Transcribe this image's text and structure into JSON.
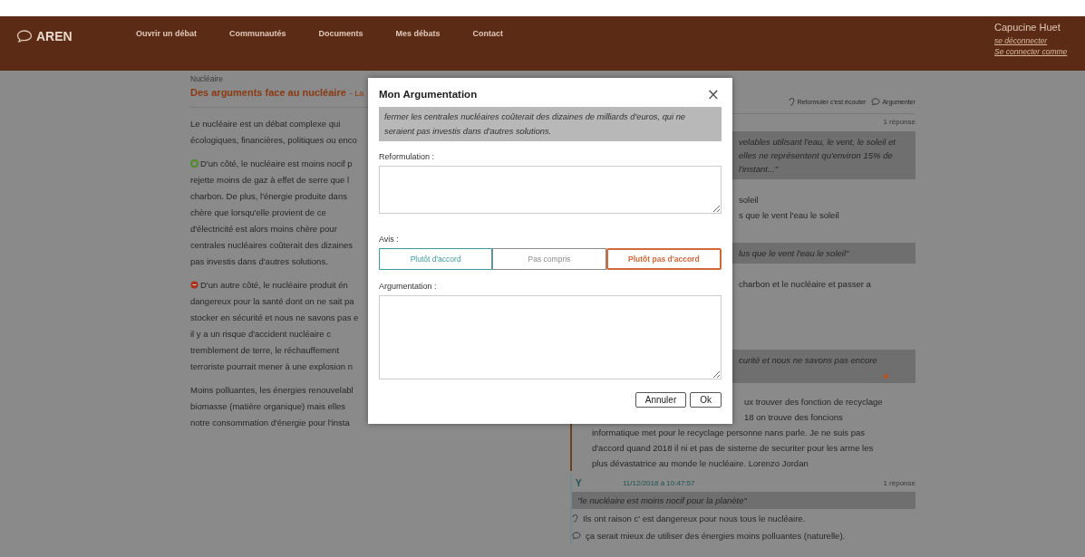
{
  "header": {
    "logo": "AREN",
    "nav": [
      {
        "label": "Ouvrir un débat"
      },
      {
        "label": "Communautés"
      },
      {
        "label": "Documents"
      },
      {
        "label": "Mes débats"
      },
      {
        "label": "Contact"
      }
    ],
    "user": {
      "name": "Capucine Huet",
      "links": [
        "se déconnecter",
        "Se connecter comme"
      ]
    }
  },
  "article": {
    "category": "Nucléaire",
    "title": "Des arguments face au nucléaire",
    "title_suffix": "- La",
    "paragraphs": [
      {
        "kind": "plain",
        "lines": [
          "Le nucléaire est un débat complexe qui",
          "écologiques, financières, politiques ou enco"
        ]
      },
      {
        "kind": "for",
        "lines": [
          "D'un côté, le nucléaire est moins nocif p",
          "rejette moins de gaz à effet de serre que l",
          "charbon. De plus, l'énergie produite dans",
          "chère que lorsqu'elle provient de ce",
          "d'électricité est alors moins chère pour",
          "centrales nucléaires coûterait des dizaines",
          "pas investis dans d'autres solutions."
        ]
      },
      {
        "kind": "against",
        "lines": [
          "D'un autre côté, le nucléaire produit én",
          "dangereux pour la santé dont on ne sait pa",
          "stocker en sécurité et nous ne savons pas e",
          "il y a un risque d'accident nucléaire c",
          "tremblement de terre, le réchauffement",
          "terroriste pourrait mener à une explosion n"
        ]
      },
      {
        "kind": "plain",
        "lines": [
          "Moins polluantes, les énergies renouvelabl",
          "biomasse (matière organique) mais elles",
          "notre consommation d'énergie pour l'insta"
        ]
      }
    ]
  },
  "discussion": {
    "actions": [
      {
        "kind": "reformulate",
        "label": "Reformuler c'est écouter"
      },
      {
        "kind": "argue",
        "label": "Argumenter"
      }
    ],
    "blocks": [
      {
        "kind": "count",
        "text": "1 réponse"
      },
      {
        "kind": "quote",
        "lines": [
          "velables utilisant l'eau, le vent, le soleil et",
          "elles ne représentent qu'environ 15% de",
          "l'instant...\""
        ]
      },
      {
        "kind": "text",
        "lines": [
          "soleil",
          "s que le vent l'eau le soleil"
        ]
      },
      {
        "kind": "quote",
        "lines": [
          "lus que le vent l'eau le soleil\""
        ]
      },
      {
        "kind": "text",
        "lines": [
          "charbon et le nucléaire et passer a"
        ]
      },
      {
        "kind": "quote",
        "lines": [
          "curité et nous ne savons pas encore"
        ]
      },
      {
        "kind": "reply",
        "lines": [
          {
            "kind": "partial",
            "text": "ux trouver des fonction de recyclage"
          },
          {
            "kind": "partial",
            "text": "18 on trouve des foncions"
          },
          {
            "kind": "full",
            "text": "informatique met pour le recyclage personne nans parle. Je ne suis pas"
          },
          {
            "kind": "full",
            "text": "d'accord quand 2018 il ni et pas de sisteme de securiter pour les arme les"
          },
          {
            "kind": "full",
            "text": "plus dévastatrice au monde le nucléaire. Lorenzo Jordan"
          }
        ]
      },
      {
        "kind": "comment",
        "author": "Y",
        "date": "11/12/2018 à 10:47:57",
        "count": "1 réponse",
        "quote": "\"le nucléaire est moins nocif pour la planète\"",
        "replies": [
          {
            "kind": "reformulation",
            "text": "Ils ont raison c' est dangereux pour nous tous le nucléaire."
          },
          {
            "kind": "argument",
            "text": "ça serait mieux de utiliser des énergies moins polluantes (naturelle)."
          }
        ]
      }
    ]
  },
  "modal": {
    "title": "Mon Argumentation",
    "close": "×",
    "quote": "fermer les centrales nucléaires coûterait des dizaines de milliards d'euros, qui ne seraient pas investis dans d'autres solutions.",
    "reformulation_label": "Reformulation :",
    "avis_label": "Avis :",
    "avis": [
      {
        "label": "Plutôt d'accord",
        "color": "#3f9a9a",
        "selected": false
      },
      {
        "label": "Pas compris",
        "color": "#8a8a8a",
        "selected": false
      },
      {
        "label": "Plutôt pas d'accord",
        "color": "#d0683a",
        "selected": true
      }
    ],
    "argumentation_label": "Argumentation :",
    "buttons": [
      "Annuler",
      "Ok"
    ]
  }
}
